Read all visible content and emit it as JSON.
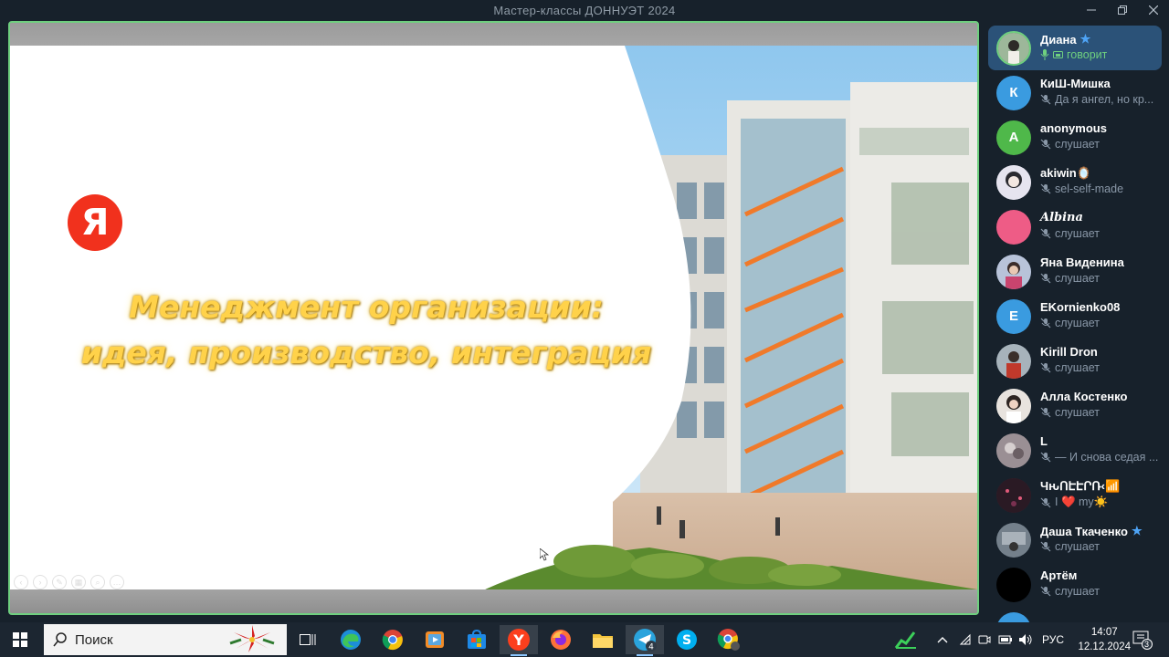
{
  "window": {
    "title": "Мастер-классы ДОННУЭТ 2024",
    "minimize_icon": "minimize-icon",
    "maximize_icon": "maximize-icon",
    "close_icon": "close-icon"
  },
  "slide": {
    "logo_text": "Я",
    "title_line1": "Менеджмент организации:",
    "title_line2": "идея, производство, интеграция",
    "title_color": "#ffd24a",
    "logo_color": "#f1311d"
  },
  "participants": [
    {
      "name": "Диана",
      "status": "говорит",
      "speaking": true,
      "star": true,
      "initial": "",
      "color": "#7a8f7a"
    },
    {
      "name": "КиШ-Мишка",
      "status": "Да я ангел, но кр...",
      "speaking": false,
      "star": false,
      "initial": "К",
      "color": "#3a9be0"
    },
    {
      "name": "anonymous",
      "status": "слушает",
      "speaking": false,
      "star": false,
      "initial": "A",
      "color": "#4fb84a"
    },
    {
      "name": "akiwin🪞",
      "status": "sel-self-made",
      "speaking": false,
      "star": false,
      "initial": "",
      "color": "#d8d8e8"
    },
    {
      "name": "𝑨𝒍𝒃𝒊𝒏𝒂",
      "status": "слушает",
      "speaking": false,
      "star": false,
      "initial": "",
      "color": "#ee5c86"
    },
    {
      "name": "Яна Виденина",
      "status": "слушает",
      "speaking": false,
      "star": false,
      "initial": "",
      "color": "#9aa8c4"
    },
    {
      "name": "EKornienko08",
      "status": "слушает",
      "speaking": false,
      "star": false,
      "initial": "E",
      "color": "#3a9be0"
    },
    {
      "name": "Kirill Dron",
      "status": "слушает",
      "speaking": false,
      "star": false,
      "initial": "",
      "color": "#6b7a88"
    },
    {
      "name": "Алла Костенко",
      "status": "слушает",
      "speaking": false,
      "star": false,
      "initial": "",
      "color": "#d9d4cf"
    },
    {
      "name": "L",
      "status": "— И снова седая ...",
      "speaking": false,
      "star": false,
      "initial": "",
      "color": "#8a7f86"
    },
    {
      "name": "ЧԋՈԷԷՐՌ‹📶",
      "status": "I ❤️ my☀️",
      "speaking": false,
      "star": false,
      "initial": "",
      "color": "#3a2430"
    },
    {
      "name": "Даша Ткаченко",
      "status": "слушает",
      "speaking": false,
      "star": true,
      "initial": "",
      "color": "#56626e"
    },
    {
      "name": "Артём",
      "status": "слушает",
      "speaking": false,
      "star": false,
      "initial": "",
      "color": "#000000"
    }
  ],
  "taskbar": {
    "search_label": "Поиск",
    "apps": [
      "task-view",
      "edge",
      "chrome",
      "media-player",
      "microsoft-store",
      "yandex-browser",
      "firefox",
      "file-explorer",
      "telegram",
      "skype",
      "chrome-profile"
    ],
    "telegram_badge": "4",
    "tray_lang": "РУС",
    "time": "14:07",
    "date": "12.12.2024",
    "notification_count": "3"
  }
}
